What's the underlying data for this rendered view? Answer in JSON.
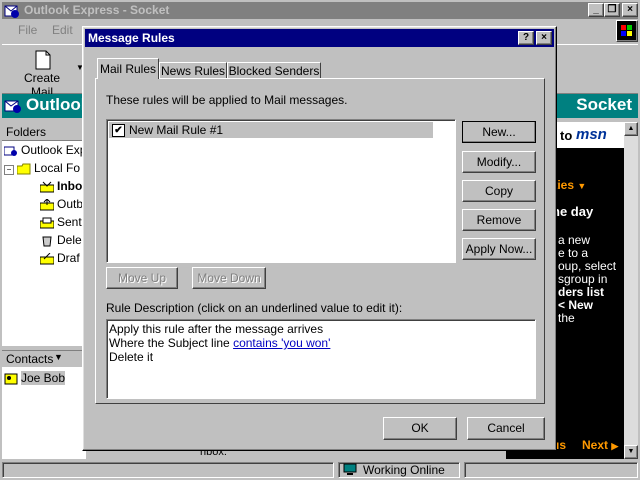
{
  "main_window": {
    "title": "Outlook Express - Socket",
    "menu": [
      "File",
      "Edit"
    ],
    "toolbar": {
      "create_mail": "Create Mail"
    },
    "banner_left": "Outlook",
    "banner_right": "Socket",
    "folders_label": "Folders",
    "tree": [
      "Outlook Expr",
      "Local Fo",
      "Inbo",
      "Outb",
      "Sent",
      "Dele",
      "Draf"
    ],
    "contacts_label": "Contacts",
    "contacts": [
      "Joe Bob"
    ],
    "right_panel": {
      "to_msn": "to",
      "msn": "msn",
      "cities": "ities",
      "the_day": "he day",
      "body_lines": [
        "a new",
        "e to a",
        "oup, select",
        "sgroup in",
        "ders list",
        "< New",
        "the"
      ],
      "nav_prev": "us",
      "nav_next": "Next"
    },
    "partial_text": "nbox:",
    "status_working": "Working Online"
  },
  "dialog": {
    "title": "Message Rules",
    "help_btn": "?",
    "close_btn": "×",
    "tabs": [
      "Mail Rules",
      "News Rules",
      "Blocked Senders"
    ],
    "intro": "These rules will be applied to Mail messages.",
    "rules": [
      {
        "name": "New Mail Rule #1",
        "checked": true
      }
    ],
    "buttons": {
      "new": "New...",
      "modify": "Modify...",
      "copy": "Copy",
      "remove": "Remove",
      "apply_now": "Apply Now...",
      "move_up": "Move Up",
      "move_down": "Move Down",
      "ok": "OK",
      "cancel": "Cancel"
    },
    "rule_desc_label": "Rule Description (click on an underlined value to edit it):",
    "rule_desc": {
      "line1": "Apply this rule after the message arrives",
      "line2_prefix": "Where the Subject line ",
      "line2_link": "contains 'you won'",
      "line3": "Delete it"
    }
  },
  "colors": {
    "titlebar_active": "#000080",
    "titlebar_inactive": "#808080",
    "face": "#c0c0c0",
    "teal_banner": "#008080",
    "msn_orange": "#ff9900"
  }
}
